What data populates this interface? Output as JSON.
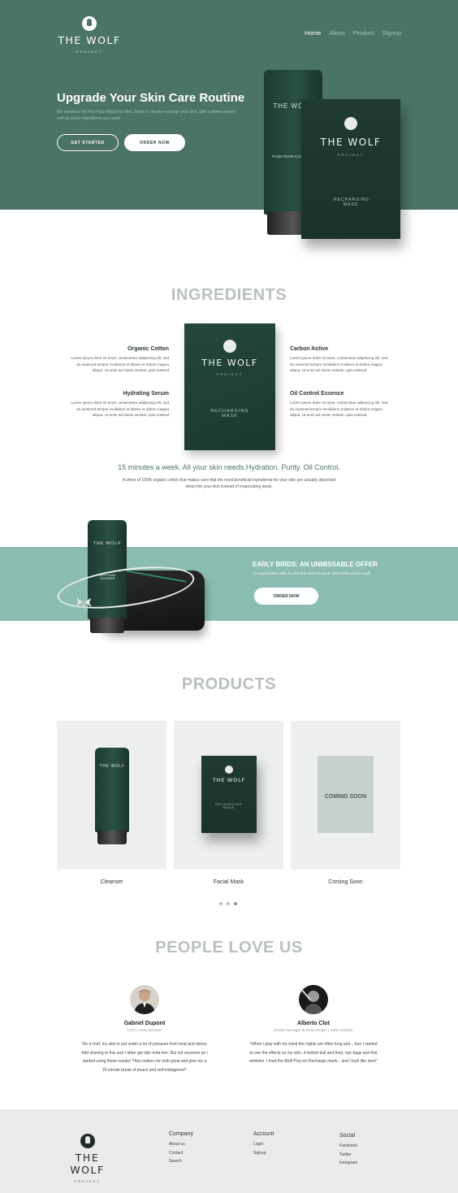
{
  "brand": {
    "name": "THE WOLF",
    "sub": "PROJECT"
  },
  "nav": {
    "items": [
      "Home",
      "About",
      "Product",
      "Signup"
    ]
  },
  "hero": {
    "title": "Upgrade Your Skin Care Routine",
    "description": "We introduce the first Face Mask For Men.  Made to deeply recharge your skin, with a sheet soaked with all active ingredients you need",
    "btn_start": "GET STARTED",
    "btn_order": "ORDER NOW",
    "tube_label": "FACE FOAM CLEANSER",
    "box_label": "RECHARGING MASK"
  },
  "ingredients": {
    "title": "INGREDIENTS",
    "items": [
      {
        "name": "Organic Cotton",
        "text": "Lorem ipsum dolor sit amet, consectetur adipiscing elit, sed do eiusmod tempor incididunt ut labore et dolore magna aliqua. Ut enim ad minim veniam, quis nostrud"
      },
      {
        "name": "Carbon Active",
        "text": "Lorem ipsum dolor sit amet, consectetur adipiscing elit, sed do eiusmod tempor incididunt ut labore et dolore magna aliqua. Ut enim ad minim veniam, quis nostrud"
      },
      {
        "name": "Hydrating Serum",
        "text": "Lorem ipsum dolor sit amet, consectetur adipiscing elit, sed do eiusmod tempor incididunt ut labore et dolore magna aliqua. Ut enim ad minim veniam, quis nostrud"
      },
      {
        "name": "Oil Control Essence",
        "text": "Lorem ipsum dolor sit amet, consectetur adipiscing elit, sed do eiusmod tempor incididunt ut labore et dolore magna aliqua. Ut enim ad minim veniam, quis nostrud"
      }
    ],
    "mask_label": "RECHARGING MASK",
    "tagline": "15 minutes a week. All your skin needs.Hydration. Purity. Oil Control.",
    "description": "A sheet of 100% organic cotton that makes sure that the most beneficial ingredients for your skin are actually absorbed deep into your skin instead of evaporating away."
  },
  "promo": {
    "title": "EARLY BIRDS: AN UNMISSABLE OFFER",
    "description": "An unmissable offer for the first ones to book. 25$ worth of free stuff!",
    "button": "ORDER NOW"
  },
  "products": {
    "title": "PRODUCTS",
    "items": [
      "Cleanser",
      "Facial Mask",
      "Coming Soon"
    ],
    "coming_badge": "COMING SOON"
  },
  "testimonials": {
    "title": "PEOPLE LOVE US",
    "items": [
      {
        "name": "Gabriel Dupont",
        "role": "Chef | early adopter",
        "quote": "\"As a chef, my skin is put under a lot of pressure from heat and stress. Add shaving to this and I often get skin irrita-tion. But not anymore as I started using these masks! They makes me look great and give me a 15-minute break of peace and self-indulgence!\""
      },
      {
        "name": "Alberto Clot",
        "role": "Media Manager & Rock Singer | early adopter",
        "quote": "\"When I play with my band the nights are often long and... fun! I started to see the effects on my skin, it looked dull and tired, eye bags and first wrinkles. I tried the Wolf Proj-ect Recharge mask... and I look like new!\""
      }
    ]
  },
  "footer": {
    "columns": [
      {
        "title": "Company",
        "links": [
          "About us",
          "Contact",
          "Search"
        ]
      },
      {
        "title": "Account",
        "links": [
          "Login",
          "Signup"
        ]
      },
      {
        "title": "Social",
        "links": [
          "Facebook",
          "Twitter",
          "Instagram"
        ]
      }
    ]
  },
  "colors": {
    "hero_bg": "#4b7366",
    "promo_bg": "#8bbdb3",
    "product_green": "#1f3b33",
    "footer_bg": "#ebebeb"
  }
}
